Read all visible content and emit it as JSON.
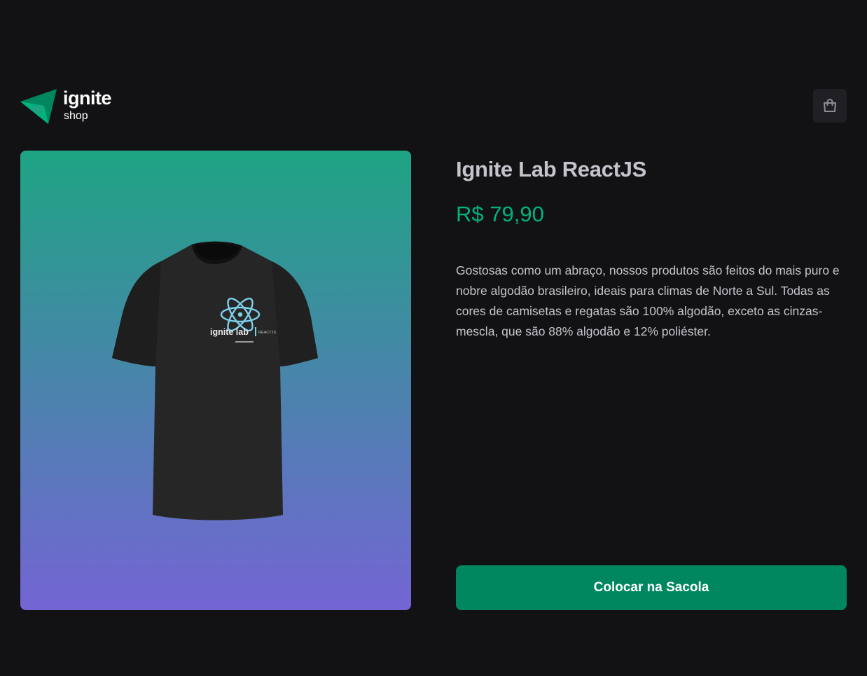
{
  "header": {
    "logo": {
      "title": "ignite",
      "subtitle": "shop",
      "icon": "ignite-logo-icon",
      "colors": [
        "#00875f",
        "#00b37e",
        "#1ea483"
      ]
    },
    "cart_icon": "shopping-bag-icon"
  },
  "product": {
    "title": "Ignite Lab ReactJS",
    "price": "R$ 79,90",
    "description": "Gostosas como um abraço, nossos produtos são feitos do mais puro e nobre algodão brasileiro, ideais para climas de Norte a Sul. Todas as cores de camisetas e regatas são 100% algodão, exceto as cinzas-mescla, que são 88% algodão e 12% poliéster.",
    "image": {
      "alt": "Camiseta Ignite Lab ReactJS",
      "print_text": "ignite lab",
      "print_subtext": "REACTJS",
      "gradient": [
        "#1ea483",
        "#7465d4"
      ]
    },
    "buy_label": "Colocar na Sacola"
  },
  "colors": {
    "background": "#121214",
    "text": "#c4c4cc",
    "price": "#00b37e",
    "button": "#00875f",
    "cart_button_bg": "#202024"
  }
}
